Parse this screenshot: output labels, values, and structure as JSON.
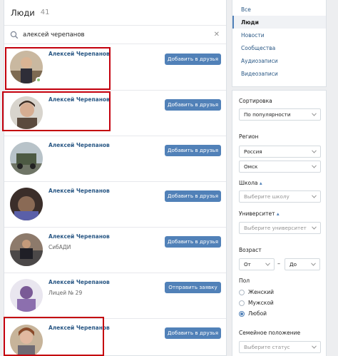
{
  "header": {
    "title": "Люди",
    "count": "41"
  },
  "search": {
    "value": "алексей черепанов"
  },
  "results": [
    {
      "name": "Алексей Черепанов",
      "subtitle": "",
      "button": "Добавить в друзья",
      "online": true,
      "highlighted": true
    },
    {
      "name": "Алексей Черепанов",
      "subtitle": "",
      "button": "Добавить в друзья",
      "online": false,
      "highlighted": true
    },
    {
      "name": "Алексей Черепанов",
      "subtitle": "",
      "button": "Добавить в друзья",
      "online": false,
      "highlighted": false
    },
    {
      "name": "Алексей Черепанов",
      "subtitle": "",
      "button": "Добавить в друзья",
      "online": false,
      "highlighted": false
    },
    {
      "name": "Алексей Черепанов",
      "subtitle": "СибАДИ",
      "button": "Добавить в друзья",
      "online": false,
      "highlighted": false
    },
    {
      "name": "Алексей Черепанов",
      "subtitle": "Лицей № 29",
      "button": "Отправить заявку",
      "online": false,
      "highlighted": false
    },
    {
      "name": "Алексей Черепанов",
      "subtitle": "",
      "button": "Добавить в друзья",
      "online": false,
      "highlighted": true
    }
  ],
  "menu": {
    "items": [
      "Все",
      "Люди",
      "Новости",
      "Сообщества",
      "Аудиозаписи",
      "Видеозаписи"
    ],
    "active": "Люди"
  },
  "filters": {
    "sort_label": "Сортировка",
    "sort_value": "По популярности",
    "region_label": "Регион",
    "country_value": "Россия",
    "city_value": "Омск",
    "school_label": "Школа",
    "school_placeholder": "Выберите школу",
    "university_label": "Университет",
    "university_placeholder": "Выберите университет",
    "age_label": "Возраст",
    "age_from": "От",
    "age_dash": "–",
    "age_to": "До",
    "gender_label": "Пол",
    "gender_options": [
      "Женский",
      "Мужской",
      "Любой"
    ],
    "gender_selected": "Любой",
    "marital_label": "Семейное положение",
    "marital_placeholder": "Выберите статус",
    "collapse_marker": "▴"
  },
  "colors": {
    "accent": "#5181b8",
    "link": "#2a5885",
    "highlight": "#c4000d",
    "online": "#8ac176"
  }
}
